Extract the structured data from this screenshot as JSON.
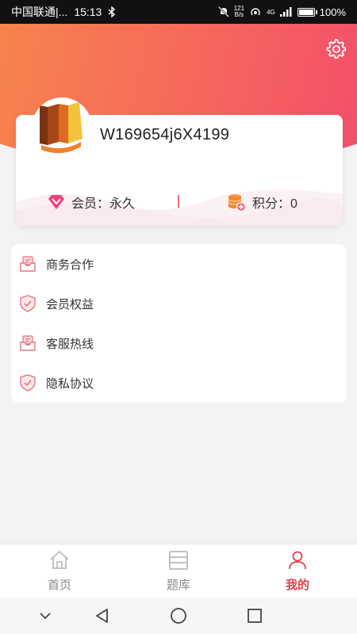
{
  "status_bar": {
    "carrier": "中国联通|...",
    "time": "15:13",
    "net_speed_value": "121",
    "net_speed_unit": "B/s",
    "network_type": "4G",
    "battery": "100%"
  },
  "profile": {
    "username": "W169654j6X4199",
    "member_label": "会员：",
    "member_value": "永久",
    "points_label": "积分：",
    "points_value": "0"
  },
  "menu": {
    "items": [
      {
        "label": "商务合作",
        "icon": "mail-box-icon"
      },
      {
        "label": "会员权益",
        "icon": "shield-check-icon"
      },
      {
        "label": "客服热线",
        "icon": "mail-box-icon"
      },
      {
        "label": "隐私协议",
        "icon": "shield-check-icon"
      }
    ]
  },
  "bottom_nav": {
    "items": [
      {
        "label": "首页",
        "icon": "home-icon",
        "active": false
      },
      {
        "label": "题库",
        "icon": "list-icon",
        "active": false
      },
      {
        "label": "我的",
        "icon": "user-icon",
        "active": true
      }
    ]
  },
  "colors": {
    "accent": "#e0404a",
    "gradient_start": "#f6844d",
    "gradient_end": "#f2506a"
  }
}
